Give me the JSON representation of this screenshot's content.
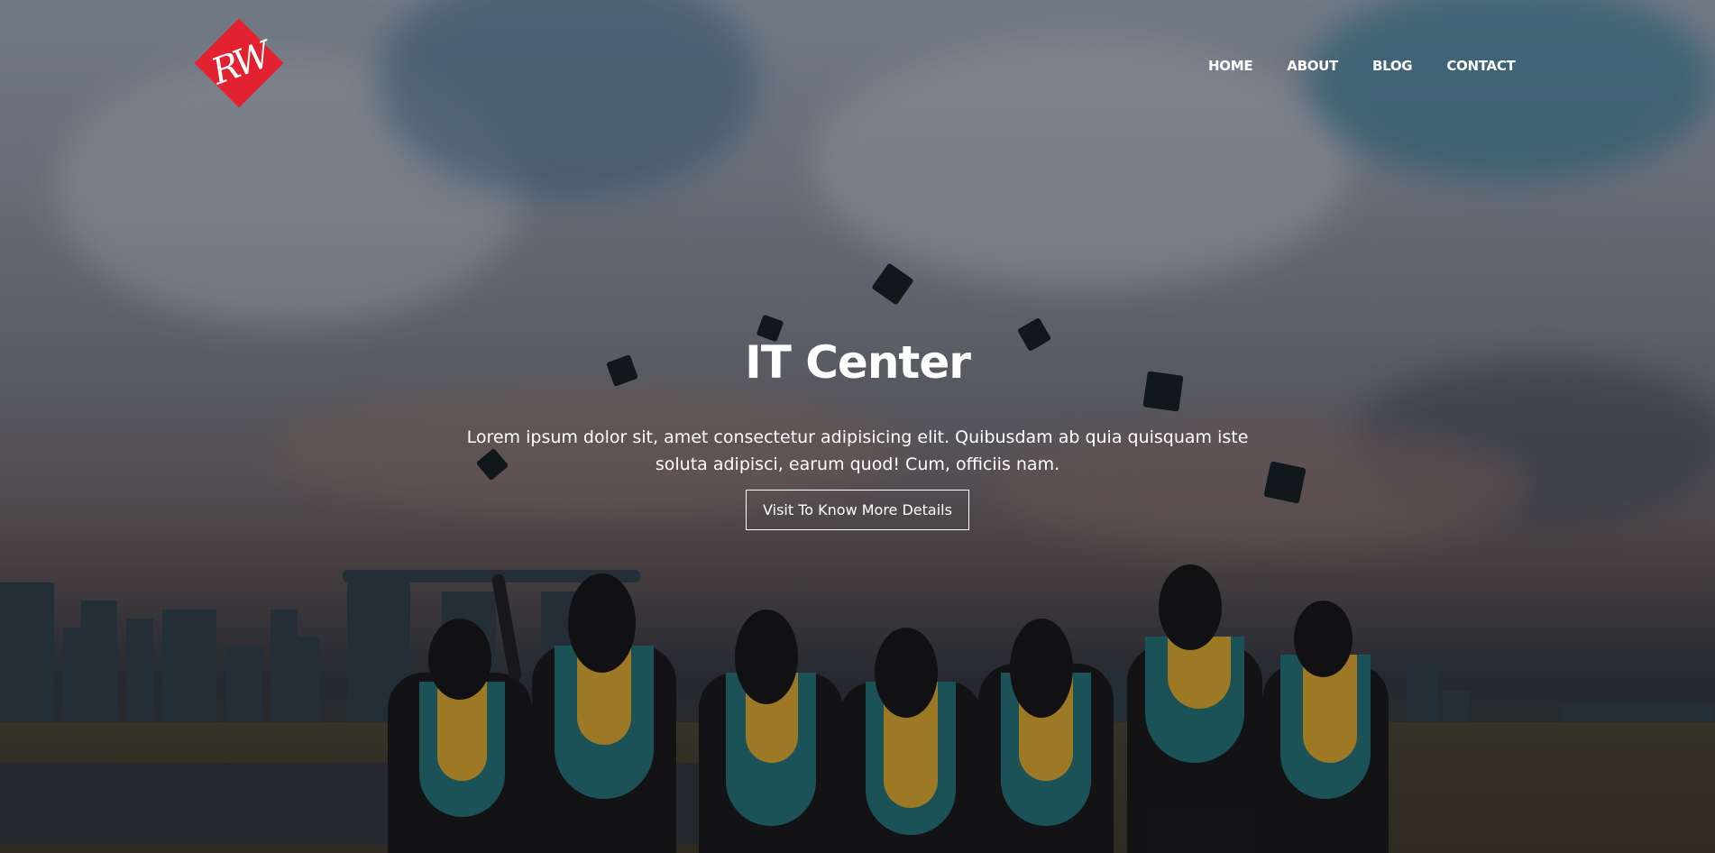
{
  "header": {
    "logo_text": "RW",
    "nav": [
      {
        "label": "HOME"
      },
      {
        "label": "ABOUT"
      },
      {
        "label": "BLOG"
      },
      {
        "label": "CONTACT"
      }
    ]
  },
  "hero": {
    "title": "IT Center",
    "description": "Lorem ipsum dolor sit, amet consectetur adipisicing elit. Quibusdam ab quia quisquam iste soluta adipisci, earum quod! Cum, officiis nam.",
    "cta_label": "Visit To Know More Details"
  },
  "colors": {
    "logo": "#e32231",
    "text": "#ffffff"
  }
}
